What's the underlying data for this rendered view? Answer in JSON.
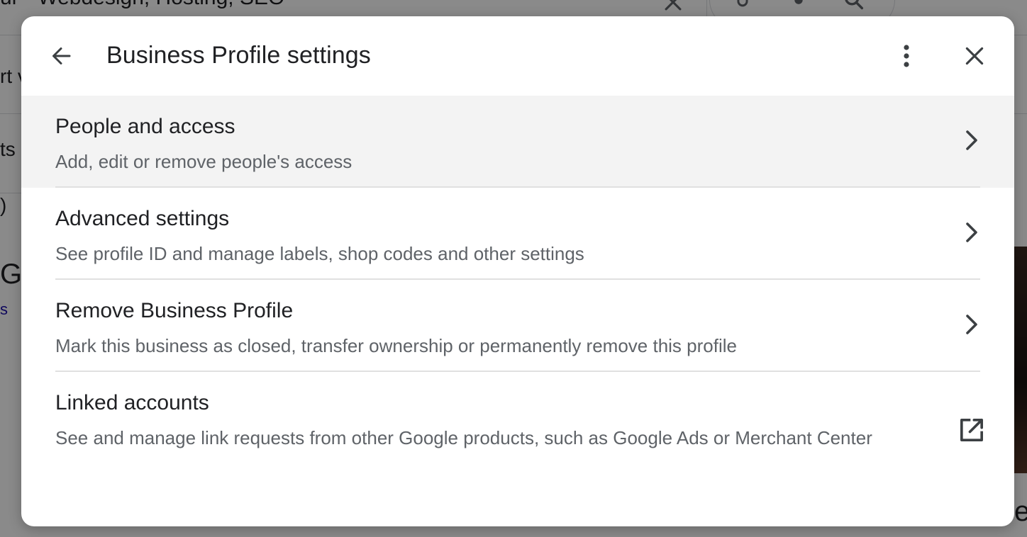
{
  "background": {
    "query_text": "ur - Webdesign, Hosting, SEO",
    "partial_texts": [
      "rt v",
      "ts",
      ")",
      "G",
      "s",
      "e"
    ]
  },
  "dialog": {
    "title": "Business Profile settings",
    "back_icon": "arrow-back-icon",
    "more_icon": "more-vertical-icon",
    "close_icon": "close-icon",
    "items": [
      {
        "title": "People and access",
        "description": "Add, edit or remove people's access",
        "action_icon": "chevron-right-icon"
      },
      {
        "title": "Advanced settings",
        "description": "See profile ID and manage labels, shop codes and other settings",
        "action_icon": "chevron-right-icon"
      },
      {
        "title": "Remove Business Profile",
        "description": "Mark this business as closed, transfer ownership or permanently remove this profile",
        "action_icon": "chevron-right-icon"
      },
      {
        "title": "Linked accounts",
        "description": "See and manage link requests from other Google products, such as Google Ads or Merchant Center",
        "action_icon": "open-in-new-icon"
      }
    ]
  },
  "colors": {
    "scrim": "#000000",
    "dialog_background": "#ffffff",
    "highlight_row": "#f3f3f3",
    "title_text": "#202124",
    "secondary_text": "#5f6368",
    "divider": "#e0e0e0"
  }
}
